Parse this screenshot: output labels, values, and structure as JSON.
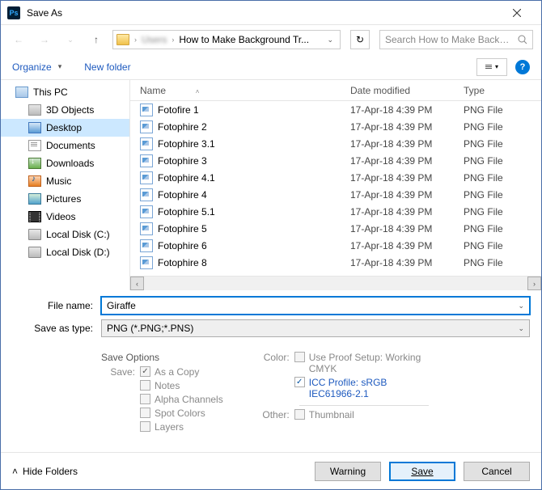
{
  "window": {
    "title": "Save As"
  },
  "nav": {
    "crumb_hidden": "Users",
    "crumb": "How to Make Background Tr...",
    "search_placeholder": "Search How to Make Backgro...",
    "refresh_glyph": "↻"
  },
  "toolbar": {
    "organize": "Organize",
    "new_folder": "New folder"
  },
  "sidebar": {
    "items": [
      {
        "label": "This PC",
        "icon": "ic-pc",
        "level": 0
      },
      {
        "label": "3D Objects",
        "icon": "ic-3d",
        "level": 1
      },
      {
        "label": "Desktop",
        "icon": "ic-desktop",
        "level": 1,
        "selected": true
      },
      {
        "label": "Documents",
        "icon": "ic-doc",
        "level": 1
      },
      {
        "label": "Downloads",
        "icon": "ic-down",
        "level": 1
      },
      {
        "label": "Music",
        "icon": "ic-music",
        "level": 1
      },
      {
        "label": "Pictures",
        "icon": "ic-pic",
        "level": 1
      },
      {
        "label": "Videos",
        "icon": "ic-vid",
        "level": 1
      },
      {
        "label": "Local Disk (C:)",
        "icon": "ic-disk",
        "level": 1
      },
      {
        "label": "Local Disk (D:)",
        "icon": "ic-disk",
        "level": 1
      }
    ]
  },
  "columns": {
    "name": "Name",
    "date": "Date modified",
    "type": "Type"
  },
  "files": [
    {
      "name": "Fotofire 1",
      "date": "17-Apr-18 4:39 PM",
      "type": "PNG File"
    },
    {
      "name": "Fotophire 2",
      "date": "17-Apr-18 4:39 PM",
      "type": "PNG File"
    },
    {
      "name": "Fotophire 3.1",
      "date": "17-Apr-18 4:39 PM",
      "type": "PNG File"
    },
    {
      "name": "Fotophire 3",
      "date": "17-Apr-18 4:39 PM",
      "type": "PNG File"
    },
    {
      "name": "Fotophire 4.1",
      "date": "17-Apr-18 4:39 PM",
      "type": "PNG File"
    },
    {
      "name": "Fotophire 4",
      "date": "17-Apr-18 4:39 PM",
      "type": "PNG File"
    },
    {
      "name": "Fotophire 5.1",
      "date": "17-Apr-18 4:39 PM",
      "type": "PNG File"
    },
    {
      "name": "Fotophire 5",
      "date": "17-Apr-18 4:39 PM",
      "type": "PNG File"
    },
    {
      "name": "Fotophire 6",
      "date": "17-Apr-18 4:39 PM",
      "type": "PNG File"
    },
    {
      "name": "Fotophire 8",
      "date": "17-Apr-18 4:39 PM",
      "type": "PNG File"
    }
  ],
  "form": {
    "filename_label": "File name:",
    "filename_value": "Giraffe",
    "type_label": "Save as type:",
    "type_value": "PNG (*.PNG;*.PNS)"
  },
  "options": {
    "save_options_hdr": "Save Options",
    "save_label": "Save:",
    "as_a_copy": "As a Copy",
    "notes": "Notes",
    "alpha": "Alpha Channels",
    "spot": "Spot Colors",
    "layers": "Layers",
    "color_label": "Color:",
    "proof": "Use Proof Setup: Working CMYK",
    "icc": "ICC Profile:  sRGB IEC61966-2.1",
    "other_label": "Other:",
    "thumbnail": "Thumbnail"
  },
  "footer": {
    "hide": "Hide Folders",
    "warning": "Warning",
    "save": "Save",
    "cancel": "Cancel"
  }
}
